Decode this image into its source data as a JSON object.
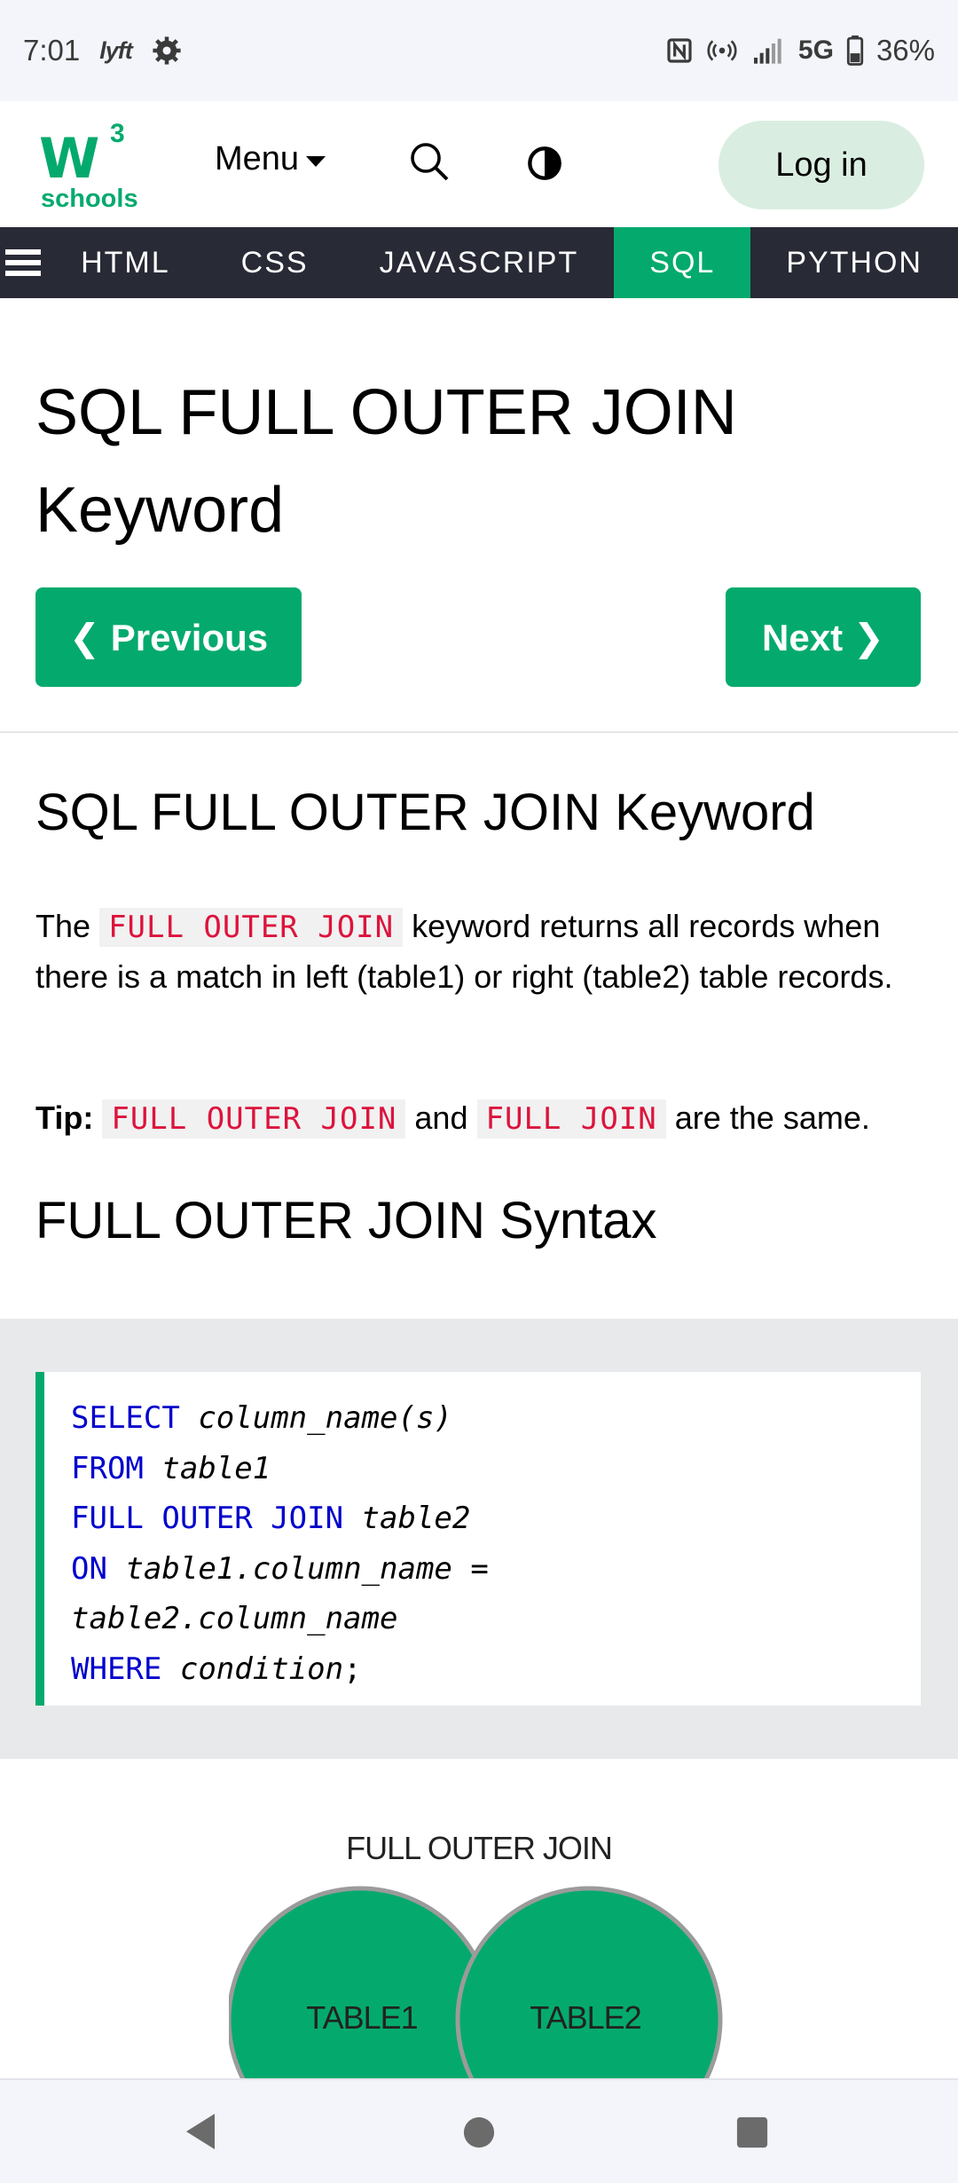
{
  "status_bar": {
    "time": "7:01",
    "app_icon_text": "lyft",
    "network": "5G",
    "battery": "36%"
  },
  "header": {
    "logo_sup": "3",
    "logo_text": "schools",
    "menu_label": "Menu",
    "login_label": "Log in"
  },
  "topnav": {
    "items": [
      "HTML",
      "CSS",
      "JAVASCRIPT",
      "SQL",
      "PYTHON"
    ],
    "active": "SQL"
  },
  "page": {
    "title_line1": "SQL FULL OUTER JOIN",
    "title_line2": "Keyword",
    "prev_label": "❮ Previous",
    "next_label": "Next ❯",
    "section_heading": "SQL FULL OUTER JOIN Keyword",
    "intro_pre": "The",
    "intro_code": "FULL OUTER JOIN",
    "intro_post": "keyword returns all records when there is a match in left (table1) or right (table2) table records.",
    "tip_label": "Tip:",
    "tip_code1": "FULL OUTER JOIN",
    "tip_and": "and",
    "tip_code2": "FULL JOIN",
    "tip_post": "are the same.",
    "syntax_heading": "FULL OUTER JOIN Syntax"
  },
  "code": {
    "l1_kw": "SELECT",
    "l1_rest": "column_name(s)",
    "l2_kw": "FROM",
    "l2_rest": "table1",
    "l3_kw": "FULL OUTER JOIN",
    "l3_rest": "table2",
    "l4_kw": "ON",
    "l4_rest": "table1.column_name",
    "l4_eq": "=",
    "l5_rest": "table2.column_name",
    "l6_kw": "WHERE",
    "l6_rest": "condition",
    "l6_end": ";"
  },
  "venn": {
    "title": "FULL OUTER JOIN",
    "left_label": "TABLE1",
    "right_label": "TABLE2",
    "fill_color": "#04aa6d"
  },
  "colors": {
    "brand_green": "#04aa6d",
    "nav_dark": "#282a35",
    "inline_code_red": "#dc143c",
    "keyword_blue": "#0000cd"
  }
}
